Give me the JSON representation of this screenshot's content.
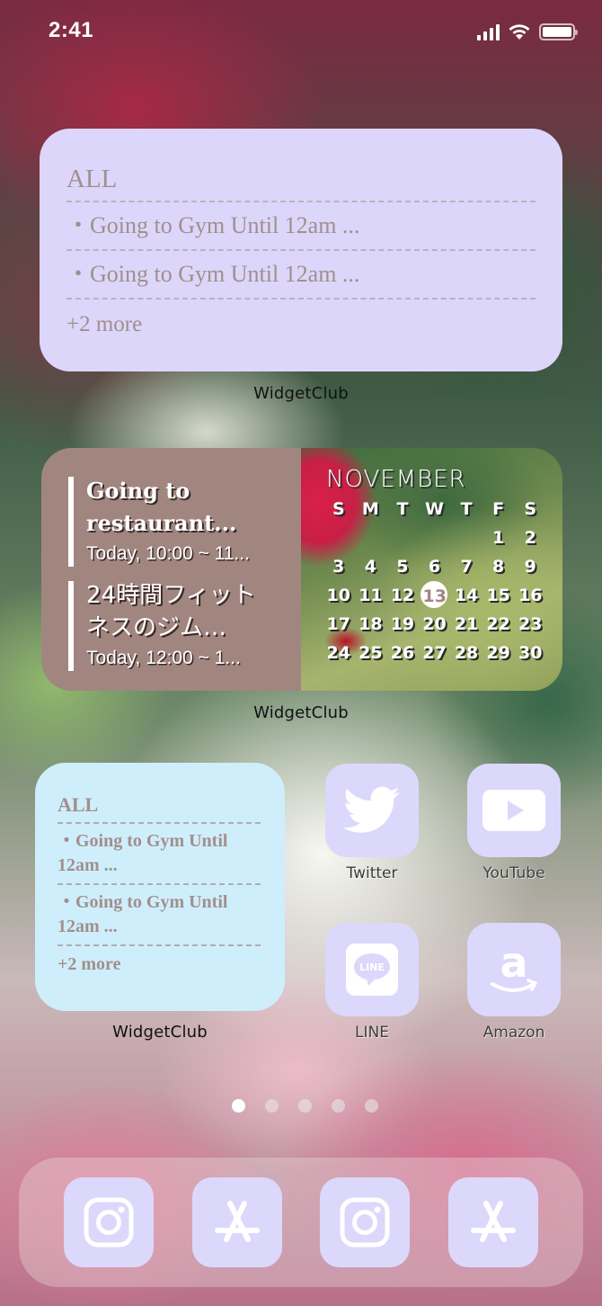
{
  "status_bar": {
    "time": "2:41",
    "signal_icon": "cellular-signal-icon",
    "wifi_icon": "wifi-icon",
    "battery_icon": "battery-icon",
    "battery_level": 1.0
  },
  "widget_todo_large": {
    "title": "ALL",
    "items": [
      "・Going to Gym Until 12am ...",
      "・Going to Gym Until 12am ..."
    ],
    "more": "+2 more",
    "label": "WidgetClub",
    "background": "#dcd6fb",
    "text_color": "#a18f8c"
  },
  "widget_events_calendar": {
    "events": [
      {
        "title": "Going to restaurant...",
        "time": "Today, 10:00 ~ 11..."
      },
      {
        "title": "24時間フィットネスのジム…",
        "time": "Today, 12:00 ~ 1..."
      }
    ],
    "calendar": {
      "month": "NOVEMBER",
      "weekdays": [
        "S",
        "M",
        "T",
        "W",
        "T",
        "F",
        "S"
      ],
      "first_weekday_index": 5,
      "days_in_month": 30,
      "today": 13
    },
    "label": "WidgetClub",
    "events_background": "#a18680"
  },
  "widget_todo_small": {
    "title": "ALL",
    "items": [
      "・Going to Gym Until 12am ...",
      "・Going to Gym Until 12am ..."
    ],
    "more": "+2 more",
    "label": "WidgetClub",
    "background": "#cfeefc"
  },
  "apps": [
    {
      "name": "Twitter",
      "icon": "twitter-bird-icon"
    },
    {
      "name": "YouTube",
      "icon": "youtube-play-icon"
    },
    {
      "name": "LINE",
      "icon": "line-chat-icon"
    },
    {
      "name": "Amazon",
      "icon": "amazon-logo-icon"
    }
  ],
  "page_dots": {
    "count": 5,
    "active_index": 0
  },
  "dock": [
    {
      "name": "Instagram",
      "icon": "instagram-icon"
    },
    {
      "name": "App Store",
      "icon": "app-store-icon"
    },
    {
      "name": "Instagram",
      "icon": "instagram-icon"
    },
    {
      "name": "App Store",
      "icon": "app-store-icon"
    }
  ],
  "icon_tile_color": "#dcd8fb"
}
